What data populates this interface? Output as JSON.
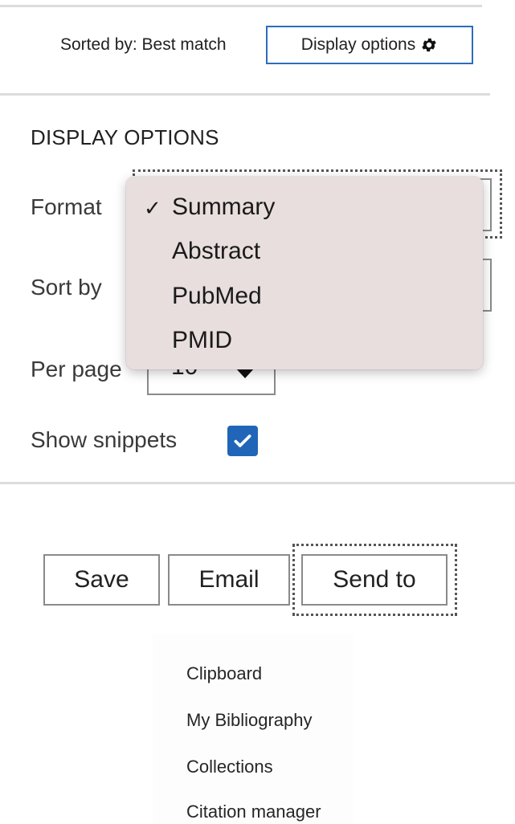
{
  "top_bar": {
    "sorted_label": "Sorted by: Best match",
    "display_options_button": "Display options",
    "button_icon": "gear-icon"
  },
  "panel": {
    "heading": "DISPLAY OPTIONS",
    "format_label": "Format",
    "sort_by_label": "Sort by",
    "per_page_label": "Per page",
    "per_page_value": "10",
    "show_snippets_label": "Show snippets",
    "show_snippets_checked": true
  },
  "format_dropdown": {
    "checkmark": "✓",
    "options": [
      "Summary",
      "Abstract",
      "PubMed",
      "PMID"
    ],
    "selected": "Summary"
  },
  "actions": {
    "save": "Save",
    "email": "Email",
    "send_to": "Send to"
  },
  "send_to_menu": {
    "items": [
      "Clipboard",
      "My Bibliography",
      "Collections",
      "Citation manager"
    ]
  },
  "colors": {
    "accent": "#2065b8",
    "button_border": "#2a6ebb",
    "dropdown_bg": "#e7dedd"
  }
}
